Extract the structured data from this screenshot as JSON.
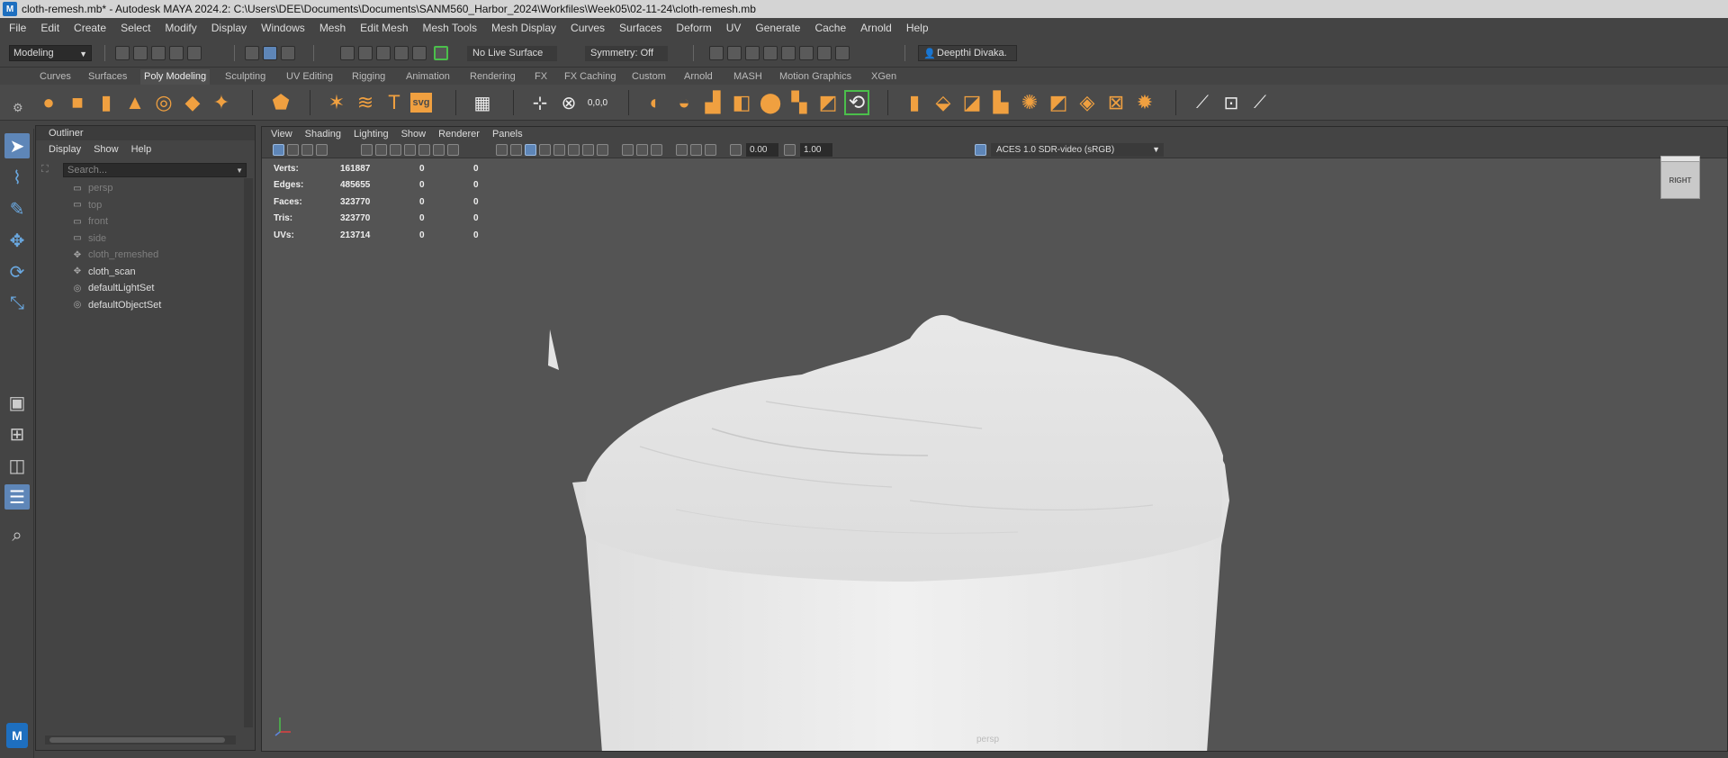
{
  "window": {
    "title": "cloth-remesh.mb* - Autodesk MAYA 2024.2: C:\\Users\\DEE\\Documents\\Documents\\SANM560_Harbor_2024\\Workfiles\\Week05\\02-11-24\\cloth-remesh.mb",
    "logo": "M"
  },
  "menu": [
    "File",
    "Edit",
    "Create",
    "Select",
    "Modify",
    "Display",
    "Windows",
    "Mesh",
    "Edit Mesh",
    "Mesh Tools",
    "Mesh Display",
    "Curves",
    "Surfaces",
    "Deform",
    "UV",
    "Generate",
    "Cache",
    "Arnold",
    "Help"
  ],
  "status_line": {
    "mode": "Modeling",
    "live_surface": "No Live Surface",
    "symmetry": "Symmetry: Off",
    "user": "Deepthi Divaka."
  },
  "shelf": {
    "tabs": [
      "Curves",
      "Surfaces",
      "Poly Modeling",
      "Sculpting",
      "UV Editing",
      "Rigging",
      "Animation",
      "Rendering",
      "FX",
      "FX Caching",
      "Custom",
      "Arnold",
      "MASH",
      "Motion Graphics",
      "XGen"
    ],
    "active_tab": "Poly Modeling",
    "svg_icon_label": "svg",
    "text_icon_label": "T"
  },
  "outliner": {
    "title": "Outliner",
    "menu": [
      "Display",
      "Show",
      "Help"
    ],
    "search_placeholder": "Search...",
    "items": [
      {
        "label": "persp",
        "icon": "camera-icon",
        "dim": true
      },
      {
        "label": "top",
        "icon": "camera-icon",
        "dim": true
      },
      {
        "label": "front",
        "icon": "camera-icon",
        "dim": true
      },
      {
        "label": "side",
        "icon": "camera-icon",
        "dim": true
      },
      {
        "label": "cloth_remeshed",
        "icon": "mesh-icon",
        "dim": true
      },
      {
        "label": "cloth_scan",
        "icon": "mesh-icon",
        "dim": false
      },
      {
        "label": "defaultLightSet",
        "icon": "set-icon",
        "dim": false
      },
      {
        "label": "defaultObjectSet",
        "icon": "set-icon",
        "dim": false
      }
    ]
  },
  "viewport": {
    "menu": [
      "View",
      "Shading",
      "Lighting",
      "Show",
      "Renderer",
      "Panels"
    ],
    "exposure": "0.00",
    "gamma": "1.00",
    "color_space": "ACES 1.0 SDR-video (sRGB)",
    "hud": [
      {
        "label": "Verts:",
        "v1": "161887",
        "v2": "0",
        "v3": "0"
      },
      {
        "label": "Edges:",
        "v1": "485655",
        "v2": "0",
        "v3": "0"
      },
      {
        "label": "Faces:",
        "v1": "323770",
        "v2": "0",
        "v3": "0"
      },
      {
        "label": "Tris:",
        "v1": "323770",
        "v2": "0",
        "v3": "0"
      },
      {
        "label": "UVs:",
        "v1": "213714",
        "v2": "0",
        "v3": "0"
      }
    ],
    "viewcube_label": "RIGHT",
    "camera_label": "persp",
    "colors": {
      "viewport_bg": "#545454",
      "mesh": "#e6e6e6",
      "accent": "#5e86b8",
      "shelf_orange": "#f0a040"
    }
  }
}
